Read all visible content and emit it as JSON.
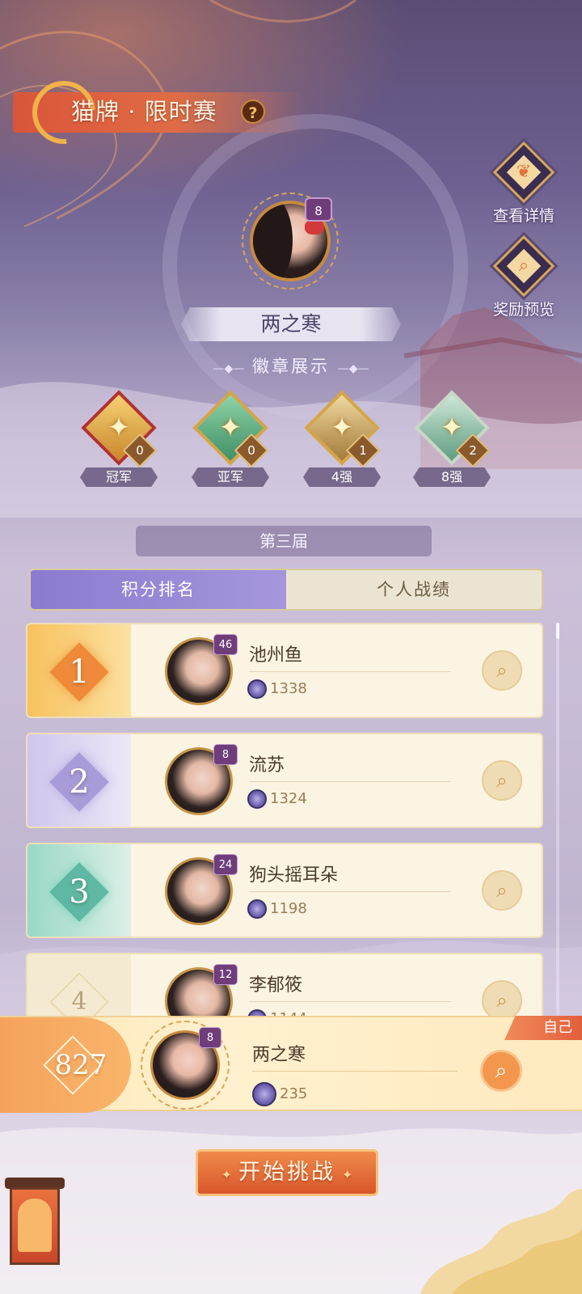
{
  "header": {
    "title": "猫牌 · 限时赛",
    "help": "?"
  },
  "side_buttons": {
    "details": "查看详情",
    "rewards": "奖励预览"
  },
  "player": {
    "name": "两之寒",
    "level": "8"
  },
  "badges": {
    "heading": "徽章展示",
    "items": [
      {
        "label": "冠军",
        "count": "0"
      },
      {
        "label": "亚军",
        "count": "0"
      },
      {
        "label": "4强",
        "count": "1"
      },
      {
        "label": "8强",
        "count": "2"
      }
    ]
  },
  "season": "第三届",
  "tabs": [
    {
      "label": "积分排名",
      "active": true
    },
    {
      "label": "个人战绩",
      "active": false
    }
  ],
  "ranking": [
    {
      "rank": "1",
      "name": "池州鱼",
      "level": "46",
      "score": "1338"
    },
    {
      "rank": "2",
      "name": "流苏",
      "level": "8",
      "score": "1324"
    },
    {
      "rank": "3",
      "name": "狗头摇耳朵",
      "level": "24",
      "score": "1198"
    },
    {
      "rank": "4",
      "name": "李郁筱",
      "level": "12",
      "score": "1144"
    }
  ],
  "self": {
    "tag": "自己",
    "rank": "827",
    "name": "两之寒",
    "level": "8",
    "score": "235"
  },
  "start_button": "开始挑战",
  "colors": {
    "accent": "#e06c45",
    "tab_active": "#8a7bd0",
    "rank1": "#f2a443",
    "rank2": "#a99ad8",
    "rank3": "#6cc3ac"
  }
}
